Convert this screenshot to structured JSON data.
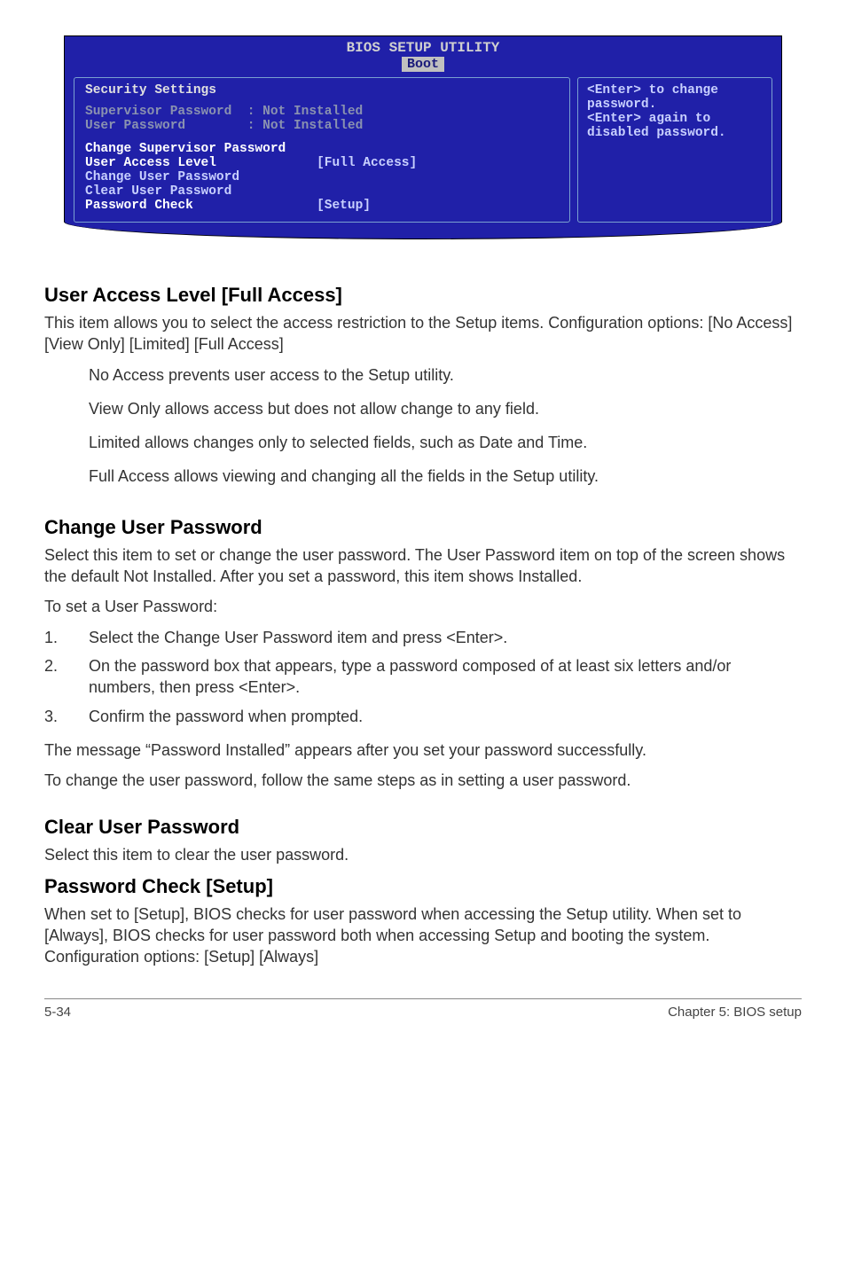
{
  "bios": {
    "title": "BIOS SETUP UTILITY",
    "tab": "Boot",
    "section_header": "Security Settings",
    "rows": {
      "supervisor_label": "Supervisor Password",
      "supervisor_value": ": Not Installed",
      "user_label": "User Password",
      "user_value": ": Not Installed",
      "change_sup": "Change Supervisor Password",
      "ual_label": "User Access Level",
      "ual_value": "[Full Access]",
      "change_user": "Change User Password",
      "clear_user": "Clear User Password",
      "pw_check_label": "Password Check",
      "pw_check_value": "[Setup]"
    },
    "help": {
      "l1": "<Enter> to change",
      "l2": "password.",
      "l3": "<Enter> again to",
      "l4": "disabled password."
    }
  },
  "sections": {
    "ual_title": "User Access Level [Full Access]",
    "ual_p1": "This item allows you to select the access restriction to the Setup items. Configuration options: [No Access] [View Only] [Limited] [Full Access]",
    "ual_i1": "No Access prevents user access to the Setup utility.",
    "ual_i2": "View Only allows access but does not allow change to any field.",
    "ual_i3": "Limited allows changes only to selected fields, such as Date and Time.",
    "ual_i4": "Full Access allows viewing and changing all the fields in the Setup utility.",
    "cup_title": "Change User Password",
    "cup_p1": "Select this item to set or change the user password. The User Password item on top of the screen shows the default Not Installed. After you set a password, this item shows Installed.",
    "cup_p2": "To set a User Password:",
    "cup_s1": "Select the Change User Password item and press <Enter>.",
    "cup_s2": "On the password box that appears, type a password composed of at least six letters and/or numbers, then press <Enter>.",
    "cup_s3": "Confirm the password when prompted.",
    "cup_p3": "The message “Password Installed” appears after you set your password successfully.",
    "cup_p4": "To change the user password, follow the same steps as in setting a user password.",
    "clr_title": "Clear User Password",
    "clr_p1": "Select this item to clear the user password.",
    "pwc_title": "Password Check [Setup]",
    "pwc_p1": "When set to [Setup], BIOS checks for user password when accessing the Setup utility. When set to [Always], BIOS checks for user password both when accessing Setup and booting the system. Configuration options: [Setup] [Always]"
  },
  "footer": {
    "page": "5-34",
    "chapter": "Chapter 5: BIOS setup"
  }
}
